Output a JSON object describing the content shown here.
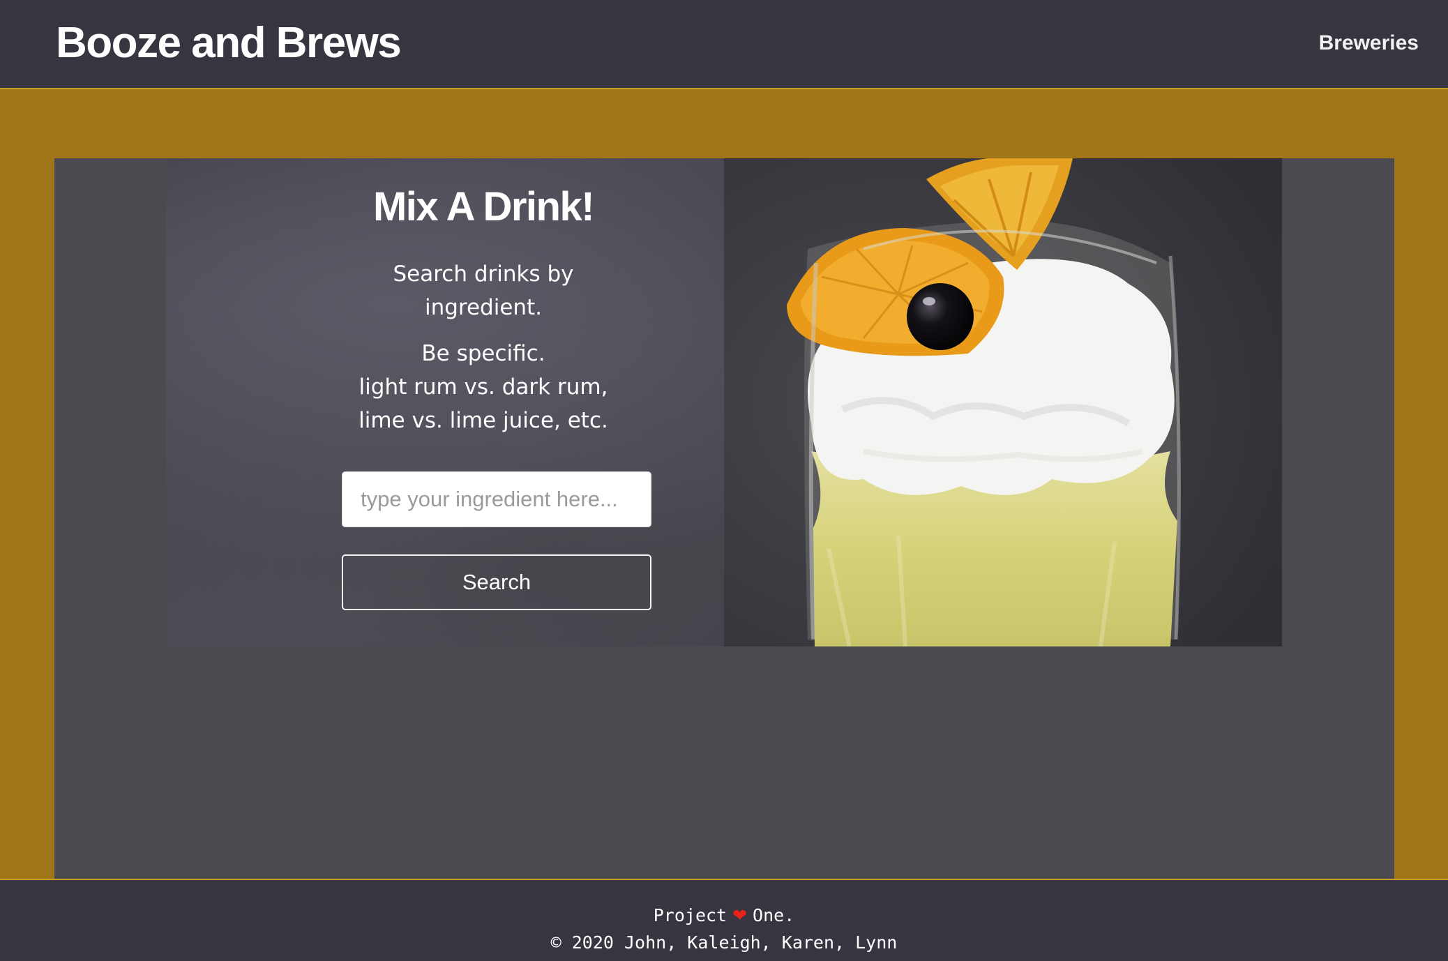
{
  "navbar": {
    "brand": "Booze and Brews",
    "link_breweries": "Breweries"
  },
  "hero": {
    "title": "Mix A Drink!",
    "intro_line1": "Search drinks by",
    "intro_line2": "ingredient.",
    "tip_line1": "Be specific.",
    "tip_line2": "light rum vs. dark rum,",
    "tip_line3": "lime vs. lime juice, etc.",
    "input_placeholder": "type your ingredient here...",
    "input_value": "",
    "search_button": "Search",
    "image": "cocktail-with-orange-slice-and-cherry"
  },
  "footer": {
    "before_heart": "Project",
    "heart_icon": "❤",
    "after_heart": "One.",
    "credits": "© 2020 John, Kaleigh, Karen, Lynn"
  },
  "colors": {
    "navbar_bg": "#37353f",
    "page_gold": "#a07418",
    "panel_bg": "#4b4a50",
    "accent_border": "#c9a020"
  }
}
